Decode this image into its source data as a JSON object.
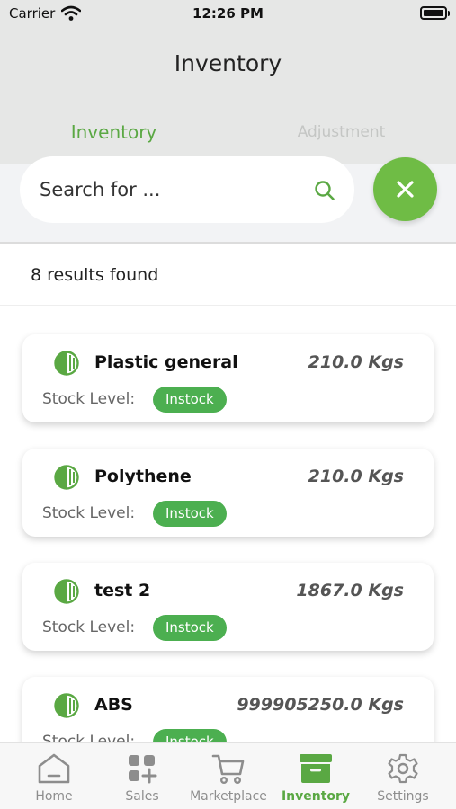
{
  "status_bar": {
    "carrier": "Carrier",
    "time": "12:26 PM"
  },
  "header": {
    "title": "Inventory"
  },
  "tabs": [
    {
      "label": "Inventory",
      "active": true
    },
    {
      "label": "Adjustment",
      "active": false
    }
  ],
  "search": {
    "placeholder": "Search for ...",
    "value": ""
  },
  "results": {
    "text": "8 results found"
  },
  "items": [
    {
      "name": "Plastic general",
      "quantity": "210.0 Kgs",
      "stock_label": "Stock Level:",
      "status": "Instock"
    },
    {
      "name": "Polythene",
      "quantity": "210.0 Kgs",
      "stock_label": "Stock Level:",
      "status": "Instock"
    },
    {
      "name": "test 2",
      "quantity": "1867.0 Kgs",
      "stock_label": "Stock Level:",
      "status": "Instock"
    },
    {
      "name": "ABS",
      "quantity": "999905250.0 Kgs",
      "stock_label": "Stock Level:",
      "status": "Instock"
    }
  ],
  "bottom_nav": [
    {
      "label": "Home",
      "icon": "home-icon",
      "active": false
    },
    {
      "label": "Sales",
      "icon": "sales-icon",
      "active": false
    },
    {
      "label": "Marketplace",
      "icon": "cart-icon",
      "active": false
    },
    {
      "label": "Inventory",
      "icon": "inventory-box-icon",
      "active": true
    },
    {
      "label": "Settings",
      "icon": "gear-icon",
      "active": false
    }
  ],
  "colors": {
    "accent": "#5aa843",
    "badge": "#4caf50",
    "inactive": "#8d8d8d"
  }
}
